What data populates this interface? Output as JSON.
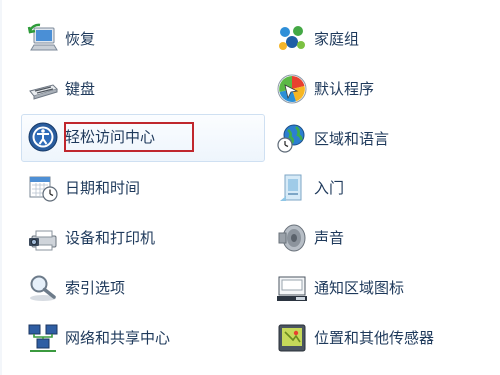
{
  "control_panel": {
    "left_items": [
      {
        "label": "恢复",
        "icon": "restore-computer-icon"
      },
      {
        "label": "键盘",
        "icon": "keyboard-icon"
      },
      {
        "label": "轻松访问中心",
        "icon": "ease-of-access-icon",
        "highlighted": true
      },
      {
        "label": "日期和时间",
        "icon": "calendar-clock-icon"
      },
      {
        "label": "设备和打印机",
        "icon": "printer-camera-icon"
      },
      {
        "label": "索引选项",
        "icon": "index-magnifier-icon"
      },
      {
        "label": "网络和共享中心",
        "icon": "network-computers-icon"
      }
    ],
    "right_items": [
      {
        "label": "家庭组",
        "icon": "homegroup-icon"
      },
      {
        "label": "默认程序",
        "icon": "default-programs-icon"
      },
      {
        "label": "区域和语言",
        "icon": "globe-clock-icon"
      },
      {
        "label": "入门",
        "icon": "getting-started-icon"
      },
      {
        "label": "声音",
        "icon": "speaker-icon"
      },
      {
        "label": "通知区域图标",
        "icon": "notification-area-icon"
      },
      {
        "label": "位置和其他传感器",
        "icon": "location-sensor-icon"
      }
    ],
    "highlight_color": "#c0272d",
    "label_color": "#1e395b"
  }
}
